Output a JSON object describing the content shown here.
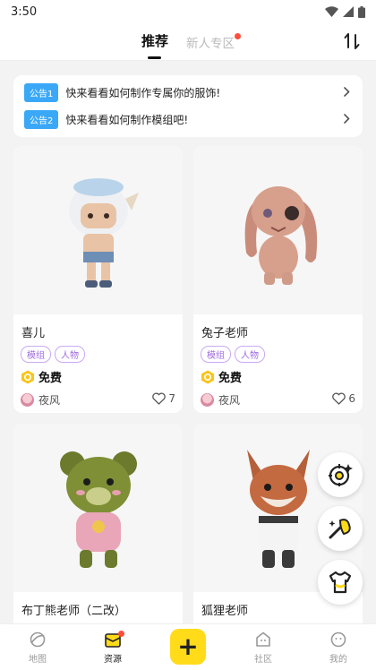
{
  "status_bar": {
    "time": "3:50"
  },
  "tabs": {
    "recommend": "推荐",
    "new_user": "新人专区"
  },
  "notices": [
    {
      "badge": "公告1",
      "text": "快来看看如何制作专属你的服饰!"
    },
    {
      "badge": "公告2",
      "text": "快来看看如何制作模组吧!"
    }
  ],
  "cards": [
    {
      "name": "喜儿",
      "tags": [
        "模组",
        "人物"
      ],
      "price": "免费",
      "author": "夜风",
      "likes": "7"
    },
    {
      "name": "兔子老师",
      "tags": [
        "模组",
        "人物"
      ],
      "price": "免费",
      "author": "夜风",
      "likes": "6"
    },
    {
      "name": "布丁熊老师（二改）"
    },
    {
      "name": "狐狸老师"
    }
  ],
  "fabs": [
    "target-sparkle-icon",
    "magic-wand-icon",
    "tshirt-icon"
  ],
  "bottom_nav": {
    "map": "地图",
    "resources": "资源",
    "add": "+",
    "community": "社区",
    "mine": "我的"
  },
  "colors": {
    "accent_yellow": "#ffdb1a",
    "notice_blue": "#3aa8f7",
    "tag_purple": "#a06be0",
    "dot_red": "#ff4d3a"
  }
}
